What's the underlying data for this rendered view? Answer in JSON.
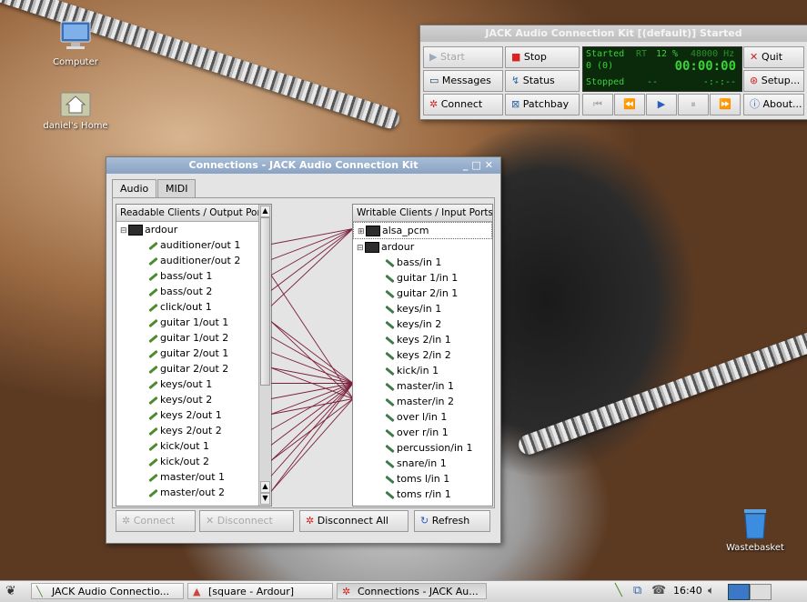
{
  "desktop": {
    "icons": [
      {
        "label": "Computer",
        "glyph": "monitor-icon"
      },
      {
        "label": "daniel's Home",
        "glyph": "home-folder-icon"
      },
      {
        "label": "Wastebasket",
        "glyph": "trash-icon"
      }
    ]
  },
  "qjackctl": {
    "title": "JACK Audio Connection Kit [(default)] Started",
    "buttons": {
      "start": "Start",
      "stop": "Stop",
      "messages": "Messages",
      "status": "Status",
      "connect": "Connect",
      "patchbay": "Patchbay",
      "quit": "Quit",
      "setup": "Setup...",
      "about": "About..."
    },
    "display": {
      "state": "Started",
      "rt": "RT",
      "cpu": "12 %",
      "rate": "48000 Hz",
      "xruns": "0 (0)",
      "time": "00:00:00",
      "transport": "Stopped",
      "bpm": "--",
      "bbt": "-:-:--"
    },
    "transport_icons": [
      "rewind-start-icon",
      "rewind-icon",
      "play-icon",
      "pause-icon",
      "fast-forward-icon"
    ]
  },
  "connections": {
    "title": "Connections - JACK Audio Connection Kit",
    "tabs": [
      "Audio",
      "MIDI"
    ],
    "readable_header": "Readable Clients / Output Ports",
    "writable_header": "Writable Clients / Input Ports",
    "readable_client": "ardour",
    "readable_ports": [
      "auditioner/out 1",
      "auditioner/out 2",
      "bass/out 1",
      "bass/out 2",
      "click/out 1",
      "guitar 1/out 1",
      "guitar 1/out 2",
      "guitar 2/out 1",
      "guitar 2/out 2",
      "keys/out 1",
      "keys/out 2",
      "keys 2/out 1",
      "keys 2/out 2",
      "kick/out 1",
      "kick/out 2",
      "master/out 1",
      "master/out 2"
    ],
    "writable_clients": [
      "alsa_pcm",
      "ardour"
    ],
    "writable_ports": [
      "bass/in 1",
      "guitar 1/in 1",
      "guitar 2/in 1",
      "keys/in 1",
      "keys/in 2",
      "keys 2/in 1",
      "keys 2/in 2",
      "kick/in 1",
      "master/in 1",
      "master/in 2",
      "over l/in 1",
      "over r/in 1",
      "percussion/in 1",
      "snare/in 1",
      "toms l/in 1",
      "toms r/in 1"
    ],
    "buttons": {
      "connect": "Connect",
      "disconnect": "Disconnect",
      "disconnect_all": "Disconnect All",
      "refresh": "Refresh"
    }
  },
  "taskbar": {
    "tasks": [
      "JACK Audio Connectio...",
      "[square - Ardour]",
      "Connections - JACK Au..."
    ],
    "clock": "16:40",
    "icons": [
      "distro-logo-icon",
      "network-icon",
      "display-icon",
      "volume-icon"
    ]
  },
  "colors": {
    "title_active": "#8aa3c4",
    "lcd_bg": "#0b2a0b",
    "lcd_fg": "#39d239",
    "connection_line": "#7a1f3a"
  }
}
